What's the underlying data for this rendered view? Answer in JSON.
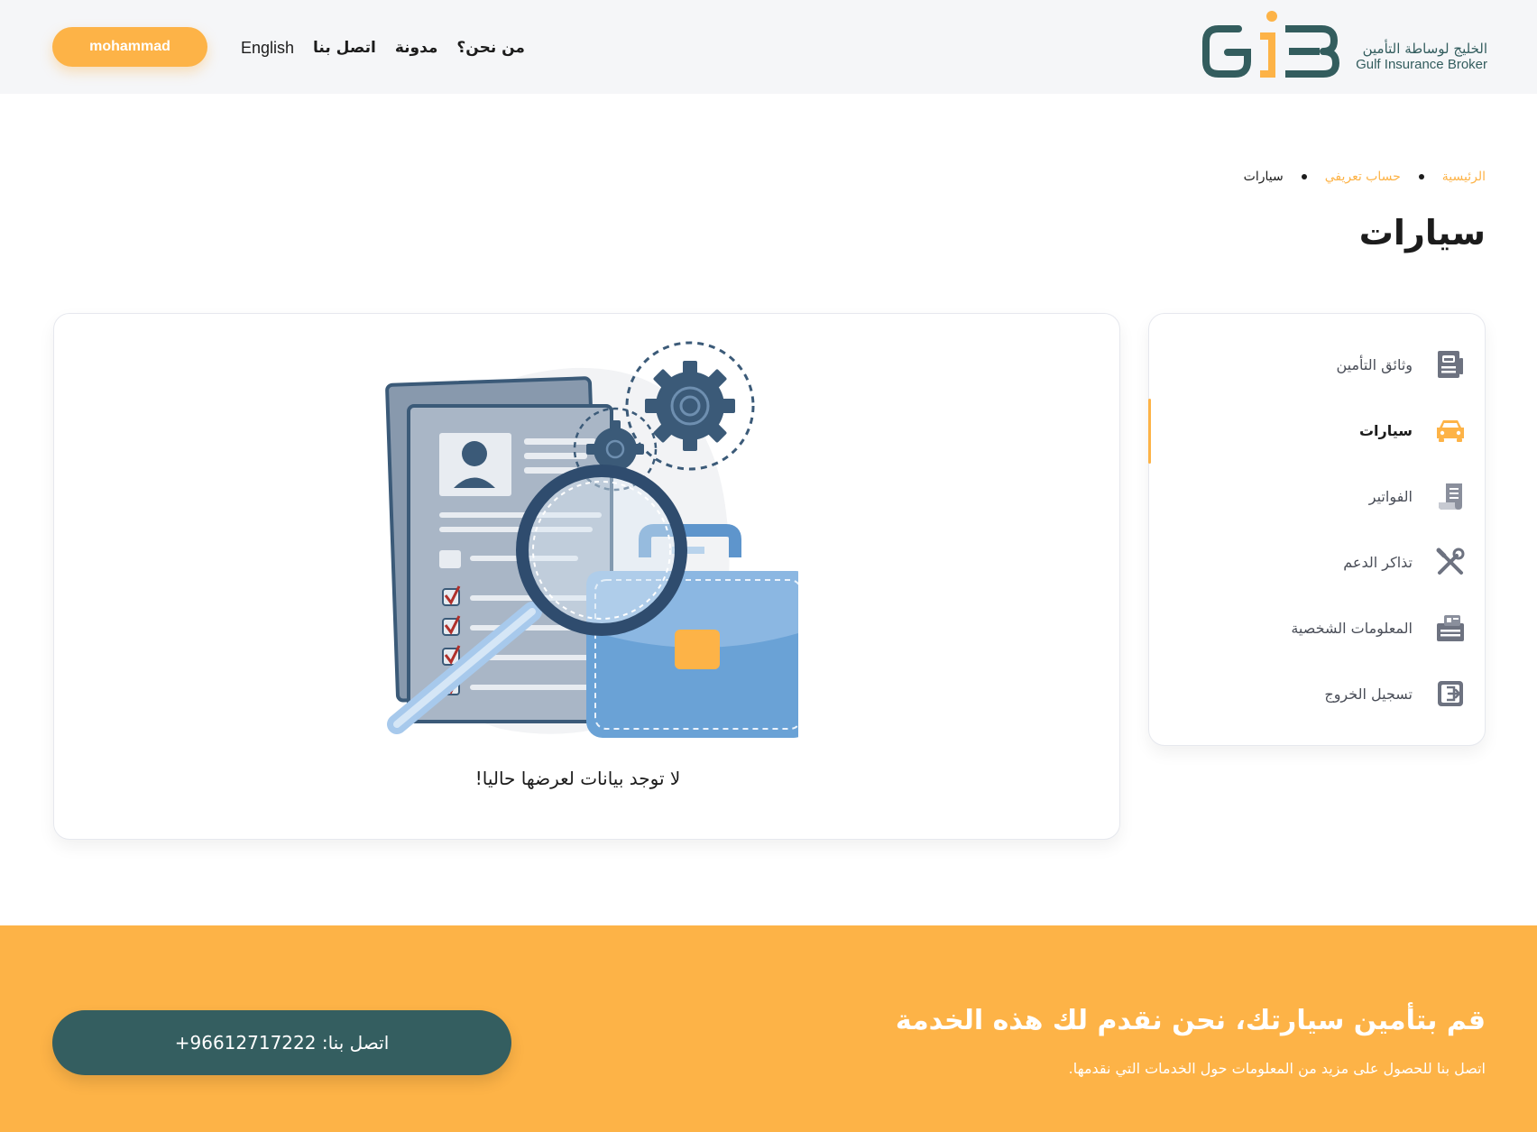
{
  "header": {
    "logo": {
      "ar": "الخليج لوساطة التأمين",
      "en": "Gulf Insurance Broker",
      "mark": "GiB"
    },
    "nav": [
      {
        "label": "من نحن؟"
      },
      {
        "label": "مدونة"
      },
      {
        "label": "اتصل بنا"
      },
      {
        "label": "English"
      }
    ],
    "user_button": "mohammad"
  },
  "breadcrumb": {
    "items": [
      {
        "label": "الرئيسية"
      },
      {
        "label": "حساب تعريفي"
      },
      {
        "label": "سيارات"
      }
    ]
  },
  "page_title": "سيارات",
  "sidebar": {
    "items": [
      {
        "label": "وثائق التأمين",
        "icon": "insurance-documents-icon"
      },
      {
        "label": "سيارات",
        "icon": "car-icon",
        "active": true
      },
      {
        "label": "الفواتير",
        "icon": "invoice-icon"
      },
      {
        "label": "تذاكر الدعم",
        "icon": "tools-icon"
      },
      {
        "label": "المعلومات الشخصية",
        "icon": "id-card-icon"
      },
      {
        "label": "تسجيل الخروج",
        "icon": "logout-icon"
      }
    ]
  },
  "content": {
    "empty_message": "لا توجد بيانات لعرضها حاليا!",
    "illustration": "documents-magnifier-briefcase-gears"
  },
  "footer": {
    "title": "قم بتأمين سيارتك، نحن نقدم لك هذه الخدمة",
    "subtitle": "اتصل بنا للحصول على مزيد من المعلومات حول الخدمات التي نقدمها.",
    "call_button": "اتصل بنا: 96612717222+"
  },
  "colors": {
    "accent": "#fdb347",
    "primary": "#345e60",
    "header_bg": "#f5f6f8"
  }
}
